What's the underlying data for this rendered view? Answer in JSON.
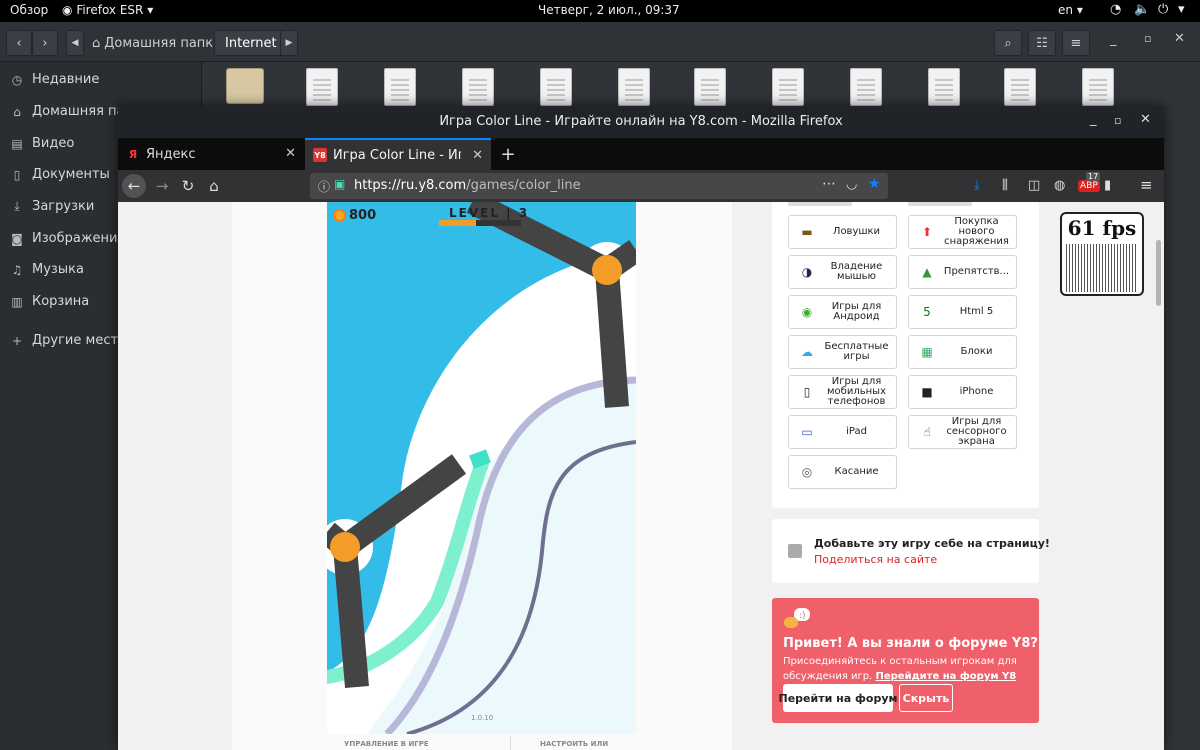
{
  "topbar": {
    "activities": "Обзор",
    "app_name": "Firefox ESR",
    "clock": "Четверг,  2 июл., 09:37",
    "lang": "en"
  },
  "files": {
    "breadcrumb": [
      "Домашняя папка",
      "Internet"
    ],
    "sidebar": [
      {
        "icon": "clock-icon",
        "label": "Недавние"
      },
      {
        "icon": "home-icon",
        "label": "Домашняя папка"
      },
      {
        "icon": "video-icon",
        "label": "Видео"
      },
      {
        "icon": "document-icon",
        "label": "Документы"
      },
      {
        "icon": "download-icon",
        "label": "Загрузки"
      },
      {
        "icon": "camera-icon",
        "label": "Изображения"
      },
      {
        "icon": "music-icon",
        "label": "Музыка"
      },
      {
        "icon": "trash-icon",
        "label": "Корзина"
      },
      {
        "icon": "plus-icon",
        "label": "Другие места"
      }
    ]
  },
  "firefox": {
    "window_title": "Игра Color Line - Играйте онлайн на Y8.com - Mozilla Firefox",
    "tabs": [
      {
        "favicon": "Я",
        "label": "Яндекс",
        "active": false
      },
      {
        "favicon": "Y8",
        "label": "Игра Color Line - Играйте",
        "active": true
      }
    ],
    "new_tab_label": "+",
    "url_host": "https://ru.y8.com",
    "url_path": "/games/color_line",
    "addon_badge": "17"
  },
  "game": {
    "score": "800",
    "level": "LEVEL | 3",
    "level_progress": 0.45,
    "version": "1.0.10",
    "controls_label": "УПРАВЛЕНИЕ В ИГРЕ",
    "settings_label": "НАСТРОИТЬ ИЛИ"
  },
  "categories": [
    {
      "icon": "trap-icon",
      "label": "Ловушки"
    },
    {
      "icon": "upgrade-icon",
      "label": "Покупка нового снаряжения"
    },
    {
      "icon": "mouse-icon",
      "label": "Владение мышью"
    },
    {
      "icon": "obstacle-icon",
      "label": "Препятств..."
    },
    {
      "icon": "android-icon",
      "label": "Игры для Андроид"
    },
    {
      "icon": "html5-icon",
      "label": "Html 5"
    },
    {
      "icon": "free-games-icon",
      "label": "Бесплатные игры"
    },
    {
      "icon": "blocks-icon",
      "label": "Блоки"
    },
    {
      "icon": "mobile-icon",
      "label": "Игры для мобильных телефонов"
    },
    {
      "icon": "iphone-icon",
      "label": "iPhone"
    },
    {
      "icon": "ipad-icon",
      "label": "iPad"
    },
    {
      "icon": "touchscreen-icon",
      "label": "Игры для сенсорного экрана"
    },
    {
      "icon": "touch-icon",
      "label": "Касание"
    }
  ],
  "share": {
    "title": "Добавьте эту игру себе на страницу!",
    "link": "Поделиться на сайте"
  },
  "forum": {
    "heading": "Привет! А вы знали о форуме Y8?",
    "text": "Присоединяйтесь к остальным игрокам для обсуждения игр.",
    "link": "Перейдите на форум Y8",
    "go_button": "Перейти на форум",
    "hide_button": "Скрыть"
  },
  "fps": "61 fps",
  "colors": {
    "game_bg": "#33bce7",
    "forum_bg": "#f0606a",
    "accent_blue": "#0a84ff",
    "share_link": "#dd2222"
  }
}
